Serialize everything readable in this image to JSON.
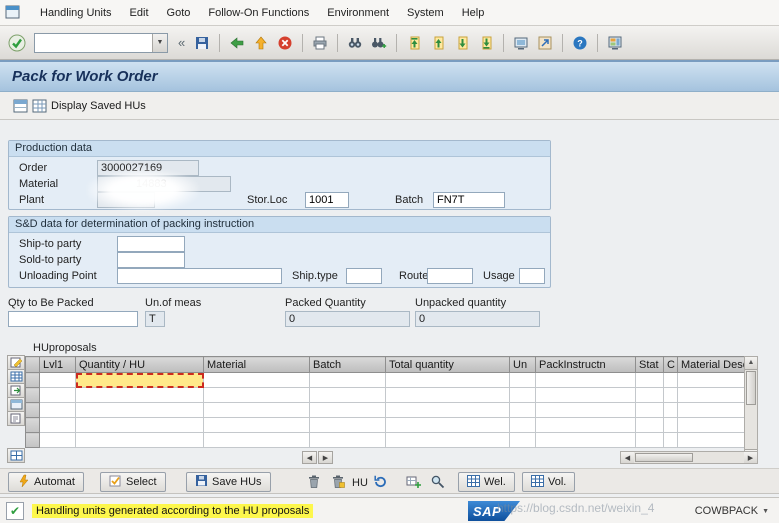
{
  "colors": {
    "status_highlight": "#fdf74c",
    "selected_cell_bg": "#ffe98a",
    "selected_cell_border": "#cc2a1e",
    "title_bar_blue": "#a5c3de",
    "sap_logo_blue": "#0e4f9c"
  },
  "menu_bar": {
    "items": [
      "Handling Units",
      "Edit",
      "Goto",
      "Follow-On Functions",
      "Environment",
      "System",
      "Help"
    ]
  },
  "toolbar": {
    "command_value": ""
  },
  "title_bar": {
    "title": "Pack for Work Order"
  },
  "app_toolbar": {
    "display_saved_hus": "Display Saved HUs"
  },
  "production": {
    "header": "Production data",
    "fields": {
      "order": {
        "label": "Order",
        "value": "3000027169"
      },
      "material": {
        "label": "Material",
        "value": "14883"
      },
      "plant": {
        "label": "Plant",
        "value": ""
      },
      "stor_loc": {
        "label": "Stor.Loc",
        "value": "1001"
      },
      "batch": {
        "label": "Batch",
        "value": "FN7T"
      }
    }
  },
  "sd_data": {
    "header": "S&D data for determination of packing instruction",
    "fields": {
      "ship_to": {
        "label": "Ship-to party",
        "value": ""
      },
      "sold_to": {
        "label": "Sold-to party",
        "value": ""
      },
      "unloading_point": {
        "label": "Unloading Point",
        "value": ""
      },
      "ship_type": {
        "label": "Ship.type",
        "value": ""
      },
      "route": {
        "label": "Route",
        "value": ""
      },
      "usage": {
        "label": "Usage",
        "value": ""
      }
    }
  },
  "quantities": {
    "qty_to_be_packed": {
      "label": "Qty to Be Packed",
      "value": ""
    },
    "unit_of_measure": {
      "label": "Un.of meas",
      "value": "T"
    },
    "packed_quantity": {
      "label": "Packed Quantity",
      "value": "0"
    },
    "unpacked_quantity": {
      "label": "Unpacked quantity",
      "value": "0"
    }
  },
  "hu_proposals": {
    "title": "HUproposals",
    "columns": [
      "Lvl1",
      "Quantity / HU",
      "Material",
      "Batch",
      "Total quantity",
      "Un",
      "PackInstructn",
      "Stat",
      "C",
      "Material Description"
    ],
    "rows": [
      [
        "",
        "",
        "",
        "",
        "",
        "",
        "",
        "",
        "",
        ""
      ],
      [
        "",
        "",
        "",
        "",
        "",
        "",
        "",
        "",
        "",
        ""
      ],
      [
        "",
        "",
        "",
        "",
        "",
        "",
        "",
        "",
        "",
        ""
      ],
      [
        "",
        "",
        "",
        "",
        "",
        "",
        "",
        "",
        "",
        ""
      ],
      [
        "",
        "",
        "",
        "",
        "",
        "",
        "",
        "",
        "",
        ""
      ]
    ],
    "selected_cell": {
      "row": 0,
      "column": 1
    }
  },
  "actions": {
    "automat": "Automat",
    "select": "Select",
    "save_hus": "Save HUs",
    "hu_label": "HU",
    "wel": "Wel.",
    "vol": "Vol."
  },
  "status_bar": {
    "message": "Handling units generated according to the HU proposals",
    "sap_logo": "SAP",
    "watermark": "https://blog.csdn.net/weixin_4",
    "system_id": "COWBPACK"
  }
}
